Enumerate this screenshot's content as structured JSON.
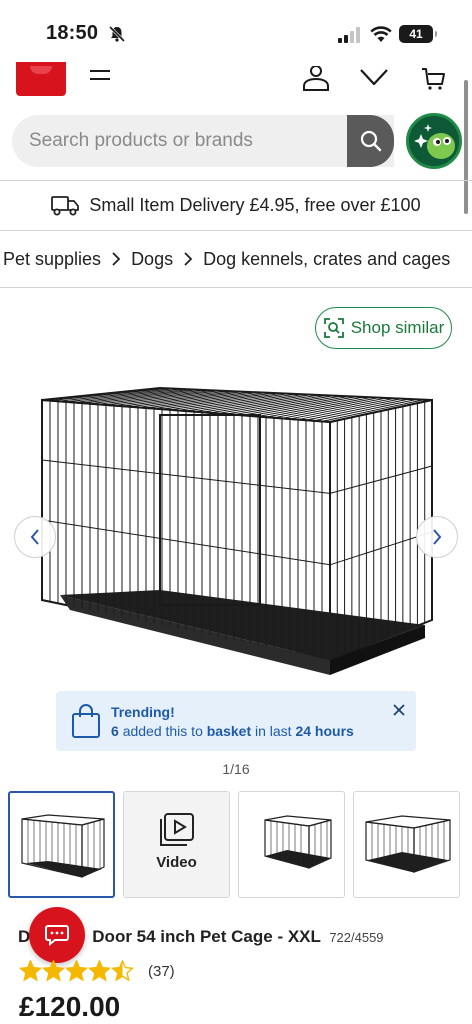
{
  "status_bar": {
    "time": "18:50",
    "battery": "41"
  },
  "search": {
    "placeholder": "Search products or brands"
  },
  "delivery": {
    "text": "Small Item Delivery £4.95, free over £100"
  },
  "breadcrumb": {
    "items": [
      "Pet supplies",
      "Dogs",
      "Dog kennels, crates and cages"
    ]
  },
  "shop_similar": {
    "label": "Shop similar"
  },
  "trending": {
    "title": "Trending!",
    "count": "6",
    "text_before": "added this to",
    "basket": "basket",
    "text_middle": "in last",
    "hours": "24 hours"
  },
  "gallery": {
    "page_indicator": "1/16"
  },
  "thumbnails": {
    "video_label": "Video"
  },
  "product": {
    "title_visible_left": "D",
    "title_visible_right": "Door 54 inch Pet Cage - XXL",
    "code": "722/4559",
    "rating": 4.5,
    "review_count": "(37)",
    "price": "£120.00"
  },
  "colors": {
    "brand_red": "#d7141e",
    "accent_green": "#1f8b45",
    "trending_blue": "#1f5aa8",
    "trending_bg": "#e6f0fb",
    "star_yellow": "#f5b800"
  }
}
